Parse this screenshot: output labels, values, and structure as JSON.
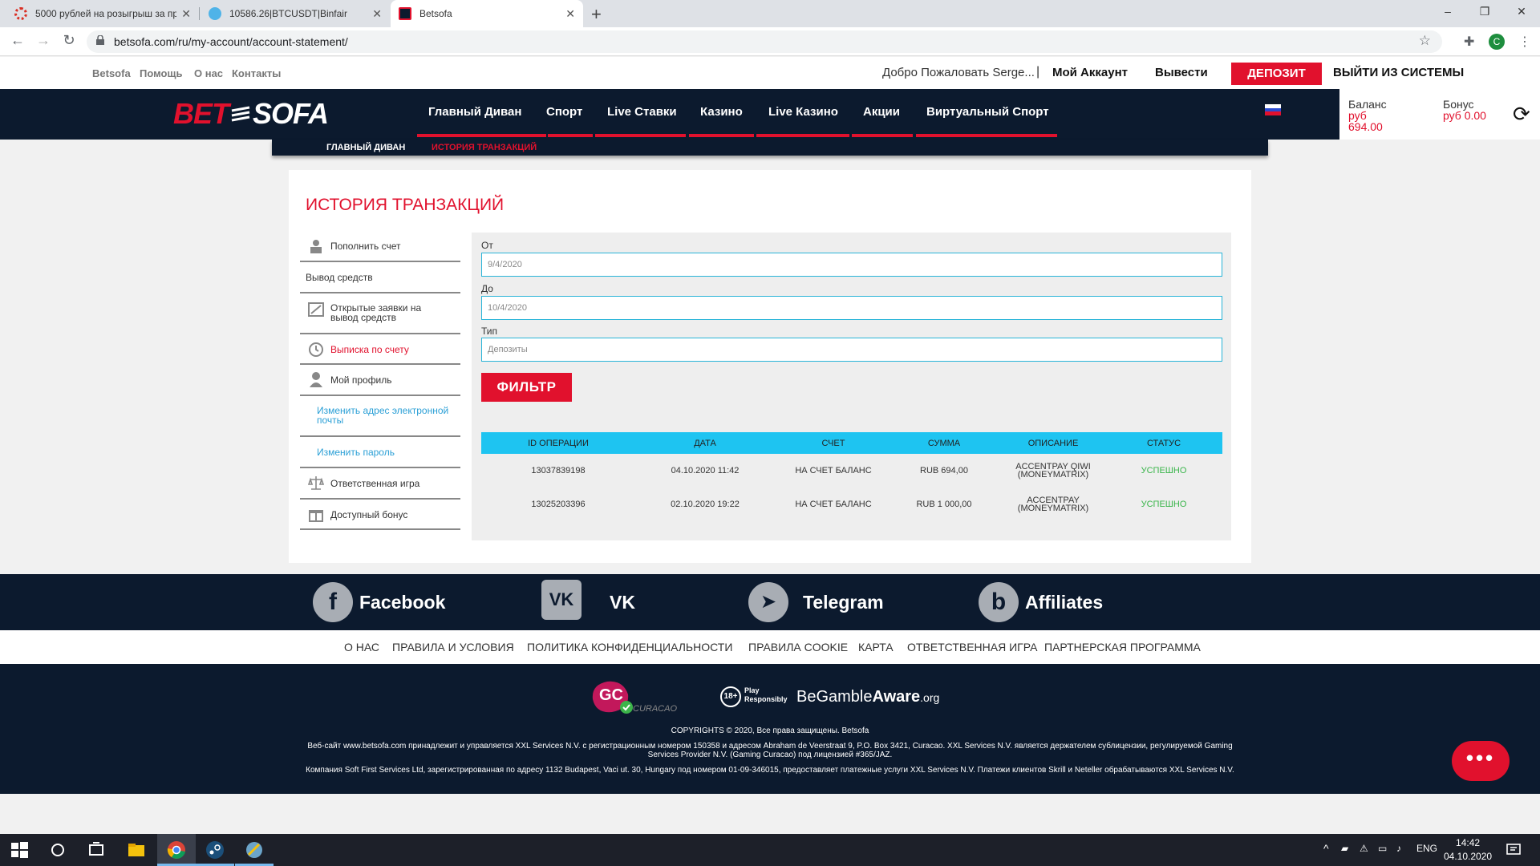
{
  "browser": {
    "tabs": [
      {
        "title": "5000 рублей на розыгрыш за пр",
        "close": "✕"
      },
      {
        "title": "10586.26|BTCUSDT|Binfair",
        "close": "✕"
      },
      {
        "title": "Betsofa",
        "close": "✕"
      }
    ],
    "new_tab": "+",
    "url": "betsofa.com/ru/my-account/account-statement/",
    "profile_initial": "C",
    "window_controls": [
      "–",
      "❐",
      "✕"
    ]
  },
  "utility": {
    "links": [
      "Betsofa",
      "Помощь",
      "О нас",
      "Контакты"
    ],
    "welcome": "Добро Пожаловать Serge...",
    "separator": "|",
    "my_account": "Мой Аккаунт",
    "withdraw": "Вывести",
    "deposit": "ДЕПОЗИТ",
    "logout": "ВЫЙТИ ИЗ СИСТЕМЫ"
  },
  "nav": {
    "logo_left": "BET",
    "logo_right": "SOFA",
    "items": [
      "Главный Диван",
      "Спорт",
      "Live Ставки",
      "Казино",
      "Live Казино",
      "Акции",
      "Виртуальный Спорт"
    ],
    "balance_label": "Баланс",
    "balance_currency": "руб",
    "balance_value": "694.00",
    "bonus_label": "Бонус",
    "bonus_value": "руб 0.00"
  },
  "breadcrumb": {
    "home": "ГЛАВНЫЙ ДИВАН",
    "current": "ИСТОРИЯ ТРАНЗАКЦИЙ"
  },
  "page": {
    "title": "ИСТОРИЯ ТРАНЗАКЦИЙ"
  },
  "sidebar": {
    "items": [
      {
        "label": "Пополнить счет",
        "icon": "deposit-icon"
      },
      {
        "label": "Вывод средств",
        "icon": ""
      },
      {
        "label": "Открытые заявки на вывод средств",
        "icon": "pending-withdraw-icon"
      },
      {
        "label": "Выписка по счету",
        "icon": "clock-icon"
      },
      {
        "label": "Мой профиль",
        "icon": "user-icon"
      },
      {
        "label": "Изменить адрес электронной почты",
        "icon": ""
      },
      {
        "label": "Изменить пароль",
        "icon": ""
      },
      {
        "label": "Ответственная игра",
        "icon": "scales-icon"
      },
      {
        "label": "Доступный бонус",
        "icon": "gift-icon"
      }
    ]
  },
  "filter": {
    "from_label": "От",
    "from_value": "9/4/2020",
    "to_label": "До",
    "to_value": "10/4/2020",
    "type_label": "Тип",
    "type_value": "Депозиты",
    "button": "ФИЛЬТР"
  },
  "table": {
    "headers": [
      "ID ОПЕРАЦИИ",
      "ДАТА",
      "СЧЕТ",
      "СУММА",
      "ОПИСАНИЕ",
      "СТАТУС"
    ],
    "rows": [
      {
        "id": "13037839198",
        "date": "04.10.2020 11:42",
        "account": "НА СЧЕТ БАЛАНС",
        "amount": "RUB 694,00",
        "desc1": "ACCENTPAY QIWI",
        "desc2": "(MONEYMATRIX)",
        "status": "УСПЕШНО"
      },
      {
        "id": "13025203396",
        "date": "02.10.2020 19:22",
        "account": "НА СЧЕТ БАЛАНС",
        "amount": "RUB 1 000,00",
        "desc1": "ACCENTPAY",
        "desc2": "(MONEYMATRIX)",
        "status": "УСПЕШНО"
      }
    ]
  },
  "social": {
    "items": [
      {
        "label": "Facebook",
        "glyph": "f"
      },
      {
        "label": "VK",
        "glyph": "VK"
      },
      {
        "label": "Telegram",
        "glyph": "➤"
      },
      {
        "label": "Affiliates",
        "glyph": "b"
      }
    ]
  },
  "footer_links": [
    "О НАС",
    "ПРАВИЛА И УСЛОВИЯ",
    "ПОЛИТИКА КОНФИДЕНЦИАЛЬНОСТИ",
    "ПРАВИЛА COOKIE",
    "КАРТА",
    "ОТВЕТСТВЕННАЯ ИГРА",
    "ПАРТНЕРСКАЯ ПРОГРАММА"
  ],
  "footer": {
    "gc_text": "GC",
    "curacao": "CURACAO",
    "age": "18+",
    "play_resp": "Play Responsibly",
    "bga_be": "Be",
    "bga_gamble": "Gamble",
    "bga_aware": "Aware",
    "bga_org": ".org",
    "copyright": "COPYRIGHTS © 2020, Все права защищены. Betsofa",
    "legal1": "Веб-сайт www.betsofa.com принадлежит и управляется XXL Services N.V. с регистрационным номером 150358 и адресом Abraham de Veerstraat 9, P.O. Box 3421, Curacao. XXL Services N.V. является держателем сублицензии, регулируемой Gaming",
    "legal2": "Services Provider N.V. (Gaming Curacao) под лицензией #365/JAZ.",
    "legal3": "Компания Soft First Services Ltd, зарегистрированная по адресу 1132 Budapest, Vaci ut. 30, Hungary под номером 01-09-346015, предоставляет платежные услуги XXL Services N.V. Платежи клиентов Skrill и Neteller обрабатываются XXL Services N.V.",
    "chat": "•••"
  },
  "taskbar": {
    "lang": "ENG",
    "time": "14:42",
    "date": "04.10.2020"
  }
}
